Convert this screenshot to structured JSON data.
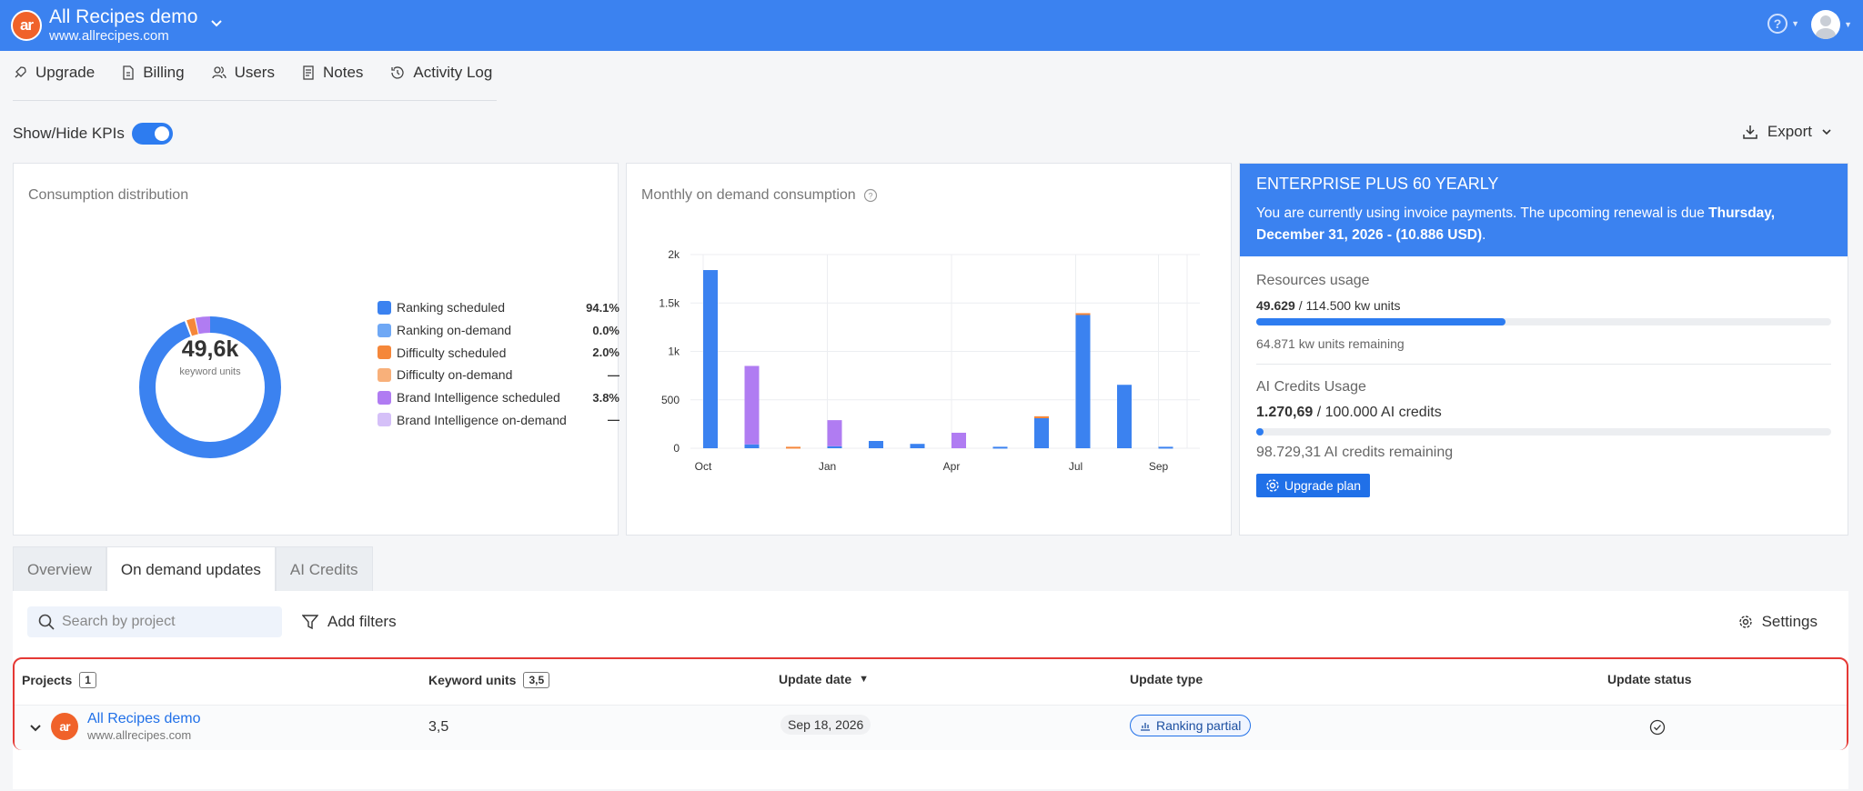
{
  "header": {
    "site_name": "All Recipes demo",
    "site_url": "www.allrecipes.com",
    "logo_text": "ar",
    "help_icon": "question-circle-icon",
    "accent": "#3b82f0"
  },
  "subnav": [
    {
      "label": "Upgrade",
      "icon": "rocket-icon"
    },
    {
      "label": "Billing",
      "icon": "document-icon"
    },
    {
      "label": "Users",
      "icon": "users-icon"
    },
    {
      "label": "Notes",
      "icon": "notes-icon"
    },
    {
      "label": "Activity Log",
      "icon": "history-icon"
    }
  ],
  "kpi_toggle": {
    "label": "Show/Hide KPIs",
    "on": true
  },
  "export_label": "Export",
  "consumption": {
    "title": "Consumption distribution",
    "total": "49,6k",
    "unit": "keyword units",
    "legend": [
      {
        "label": "Ranking scheduled",
        "value": "94.1%",
        "color": "#3b82f0"
      },
      {
        "label": "Ranking on-demand",
        "value": "0.0%",
        "color": "#6fa8f5"
      },
      {
        "label": "Difficulty scheduled",
        "value": "2.0%",
        "color": "#f5873a"
      },
      {
        "label": "Difficulty on-demand",
        "value": "—",
        "color": "#f8b07a"
      },
      {
        "label": "Brand Intelligence scheduled",
        "value": "3.8%",
        "color": "#b07cf2"
      },
      {
        "label": "Brand Intelligence on-demand",
        "value": "—",
        "color": "#d5c0f8"
      }
    ]
  },
  "monthly": {
    "title": "Monthly on demand consumption"
  },
  "chart_data": {
    "type": "bar",
    "title": "Monthly on demand consumption",
    "x_tick_labels": [
      "Oct",
      "Jan",
      "Apr",
      "Jul",
      "Sep"
    ],
    "y_tick_labels": [
      "0",
      "500",
      "1k",
      "1.5k",
      "2k"
    ],
    "ylim": [
      0,
      2000
    ],
    "bars": [
      {
        "pos": 0,
        "segments": {
          "blue": 1840
        }
      },
      {
        "pos": 1,
        "segments": {
          "blue": 40,
          "purple": 810
        }
      },
      {
        "pos": 2,
        "segments": {
          "orange": 15
        }
      },
      {
        "pos": 3,
        "segments": {
          "blue": 20,
          "purple": 270
        }
      },
      {
        "pos": 4,
        "segments": {
          "blue": 75
        }
      },
      {
        "pos": 5,
        "segments": {
          "blue": 45
        }
      },
      {
        "pos": 6,
        "segments": {
          "purple": 160
        }
      },
      {
        "pos": 7,
        "segments": {
          "blue": 15
        }
      },
      {
        "pos": 8,
        "segments": {
          "blue": 310,
          "orange": 20
        }
      },
      {
        "pos": 9,
        "segments": {
          "blue": 1380,
          "orange": 15
        }
      },
      {
        "pos": 10,
        "segments": {
          "blue": 655
        }
      },
      {
        "pos": 11,
        "segments": {
          "blue": 15
        }
      }
    ],
    "colors": {
      "blue": "#3b82f0",
      "purple": "#b07cf2",
      "orange": "#f5873a"
    },
    "grid": true
  },
  "plan": {
    "name": "ENTERPRISE PLUS 60 YEARLY",
    "desc_prefix": "You are currently using invoice payments. The upcoming renewal is due ",
    "desc_bold": "Thursday, December 31, 2026 - (10.886 USD)",
    "desc_suffix": ".",
    "resources_title": "Resources usage",
    "resources_used": "49.629",
    "resources_total": " / 114.500 kw units",
    "resources_fraction": 0.433,
    "resources_remaining": "64.871 kw units remaining",
    "ai_title": "AI Credits Usage",
    "ai_used": "1.270,69",
    "ai_total": " / 100.000 AI credits",
    "ai_fraction": 0.0127,
    "ai_remaining": "98.729,31 AI credits remaining",
    "upgrade_label": "Upgrade plan"
  },
  "tabs": [
    "Overview",
    "On demand updates",
    "AI Credits"
  ],
  "active_tab": 1,
  "search_placeholder": "Search by project",
  "filters_label": "Add filters",
  "settings_label": "Settings",
  "table": {
    "headers": {
      "projects": "Projects",
      "projects_count": "1",
      "keyword_units": "Keyword units",
      "keyword_units_count": "3,5",
      "update_date": "Update date",
      "update_type": "Update type",
      "update_status": "Update status"
    },
    "rows": [
      {
        "project": "All Recipes demo",
        "url": "www.allrecipes.com",
        "keyword_units": "3,5",
        "update_date": "Sep 18, 2026",
        "update_type": "Ranking partial",
        "status_icon": "check-circle-icon"
      }
    ]
  }
}
